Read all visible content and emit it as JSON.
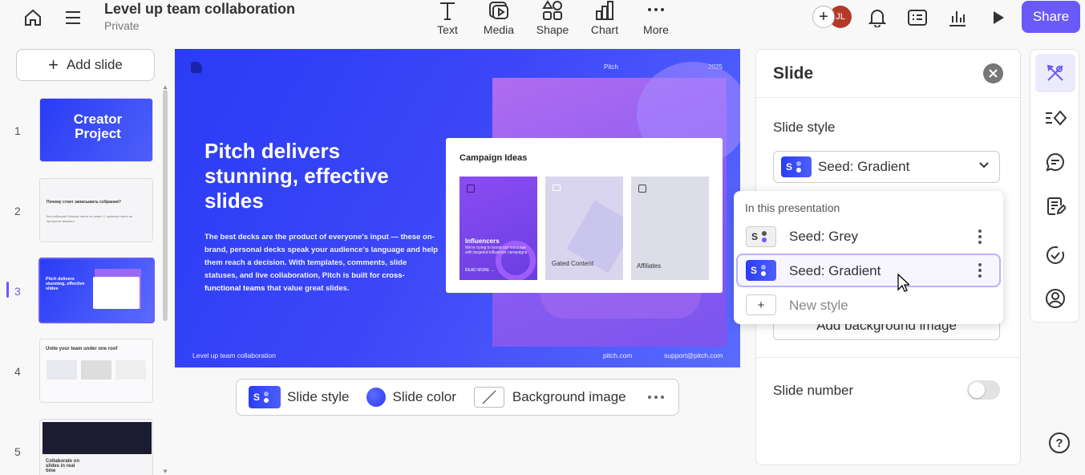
{
  "header": {
    "title": "Level up team collaboration",
    "subtitle": "Private",
    "tools": [
      {
        "label": "Text",
        "icon": "text-icon"
      },
      {
        "label": "Media",
        "icon": "media-icon"
      },
      {
        "label": "Shape",
        "icon": "shape-icon"
      },
      {
        "label": "Chart",
        "icon": "chart-icon"
      },
      {
        "label": "More",
        "icon": "more-icon"
      }
    ],
    "avatar_initials": "JL",
    "share_label": "Share"
  },
  "sidebar": {
    "add_slide_label": "Add slide",
    "slides": [
      {
        "number": "1",
        "title": "Creator Project"
      },
      {
        "number": "2",
        "title": "Почему стоит записывать собрания?",
        "body": "Без собраний больше никто не знает. С записью никто не пропустит важного."
      },
      {
        "number": "3",
        "title": "Pitch delivers stunning, effective slides"
      },
      {
        "number": "4",
        "title": "Unite your team under one roof"
      },
      {
        "number": "5",
        "title": "Collaborate on slides in real time"
      }
    ],
    "active_index": 3
  },
  "slide": {
    "brand": "Pitch",
    "year": "2025",
    "heading": "Pitch delivers stunning, effective slides",
    "body": "The best decks are the product of everyone's input — these on-brand, personal decks speak your audience's language and help them reach a decision. With templates, comments, slide statuses, and live collaboration, Pitch is built for",
    "body_bold": "cross-functional teams",
    "body_end": "that value great slides.",
    "card_title": "Campaign Ideas",
    "card_items": [
      "Influencers",
      "Gated Content",
      "Affiliates"
    ],
    "card_item_detail": "We're trying to boost our message with targeted influencer campaigns",
    "card_item_link": "READ MORE →",
    "footer_left": "Level up team collaboration",
    "footer_mid": "pitch.com",
    "footer_right": "support@pitch.com"
  },
  "slide_toolbar": {
    "style_label": "Slide style",
    "color_label": "Slide color",
    "bg_label": "Background image"
  },
  "panel": {
    "title": "Slide",
    "slide_style_heading": "Slide style",
    "selected_style": "Seed: Gradient",
    "add_bg_label": "Add background image",
    "slide_number_label": "Slide number",
    "slide_number_on": false
  },
  "dropdown": {
    "section_label": "In this presentation",
    "options": [
      "Seed: Grey",
      "Seed: Gradient"
    ],
    "selected": "Seed: Gradient",
    "new_style_label": "New style"
  },
  "colors": {
    "accent": "#6a5af9",
    "slide_blue": "#2a3cf5"
  }
}
